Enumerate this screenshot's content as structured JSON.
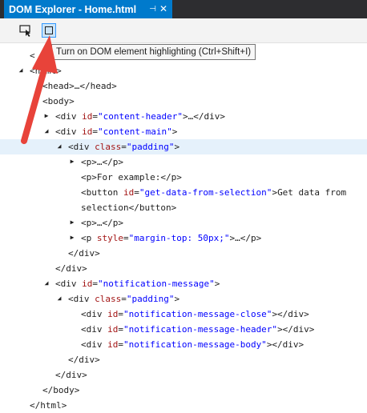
{
  "tab": {
    "title": "DOM Explorer - Home.html",
    "pin_glyph": "⊣",
    "close_glyph": "✕"
  },
  "toolbar": {
    "select_element_icon": "select-element-icon",
    "highlight_icon": "highlight-toggle-icon"
  },
  "tooltip": {
    "text": "Turn on DOM element highlighting (Ctrl+Shift+I)"
  },
  "tree": [
    {
      "indent": 37,
      "toggle": "",
      "tokens": [
        [
          "tag",
          "<"
        ]
      ]
    },
    {
      "indent": 37,
      "toggle": "expanded",
      "tokens": [
        [
          "tag",
          "<html>"
        ]
      ]
    },
    {
      "indent": 53,
      "toggle": "",
      "tokens": [
        [
          "tag",
          "<head>…</head>"
        ]
      ]
    },
    {
      "indent": 53,
      "toggle": "",
      "tokens": [
        [
          "tag",
          "<body>"
        ]
      ]
    },
    {
      "indent": 69,
      "toggle": "collapsed",
      "tokens": [
        [
          "tag",
          "<div "
        ],
        [
          "attr",
          "id"
        ],
        [
          "tag",
          "="
        ],
        [
          "val",
          "\"content-header\""
        ],
        [
          "tag",
          ">…</div>"
        ]
      ]
    },
    {
      "indent": 69,
      "toggle": "expanded",
      "tokens": [
        [
          "tag",
          "<div "
        ],
        [
          "attr",
          "id"
        ],
        [
          "tag",
          "="
        ],
        [
          "val",
          "\"content-main\""
        ],
        [
          "tag",
          ">"
        ]
      ]
    },
    {
      "indent": 85,
      "toggle": "expanded",
      "selected": true,
      "tokens": [
        [
          "tag",
          "<div "
        ],
        [
          "attr",
          "class"
        ],
        [
          "tag",
          "="
        ],
        [
          "val",
          "\"padding\""
        ],
        [
          "tag",
          ">"
        ]
      ]
    },
    {
      "indent": 101,
      "toggle": "collapsed",
      "tokens": [
        [
          "tag",
          "<p>…</p>"
        ]
      ]
    },
    {
      "indent": 101,
      "toggle": "",
      "tokens": [
        [
          "tag",
          "<p>"
        ],
        [
          "text",
          "For example:"
        ],
        [
          "tag",
          "</p>"
        ]
      ]
    },
    {
      "indent": 101,
      "toggle": "",
      "tokens": [
        [
          "tag",
          "<button "
        ],
        [
          "attr",
          "id"
        ],
        [
          "tag",
          "="
        ],
        [
          "val",
          "\"get-data-from-selection\""
        ],
        [
          "tag",
          ">"
        ],
        [
          "text",
          "Get data from"
        ]
      ]
    },
    {
      "indent": 101,
      "toggle": "",
      "tokens": [
        [
          "text",
          "selection"
        ],
        [
          "tag",
          "</button>"
        ]
      ]
    },
    {
      "indent": 101,
      "toggle": "collapsed",
      "tokens": [
        [
          "tag",
          "<p>…</p>"
        ]
      ]
    },
    {
      "indent": 101,
      "toggle": "collapsed",
      "tokens": [
        [
          "tag",
          "<p "
        ],
        [
          "attr",
          "style"
        ],
        [
          "tag",
          "="
        ],
        [
          "val",
          "\"margin-top: 50px;\""
        ],
        [
          "tag",
          ">…</p>"
        ]
      ]
    },
    {
      "indent": 85,
      "toggle": "",
      "tokens": [
        [
          "tag",
          "</div>"
        ]
      ]
    },
    {
      "indent": 69,
      "toggle": "",
      "tokens": [
        [
          "tag",
          "</div>"
        ]
      ]
    },
    {
      "indent": 69,
      "toggle": "expanded",
      "tokens": [
        [
          "tag",
          "<div "
        ],
        [
          "attr",
          "id"
        ],
        [
          "tag",
          "="
        ],
        [
          "val",
          "\"notification-message\""
        ],
        [
          "tag",
          ">"
        ]
      ]
    },
    {
      "indent": 85,
      "toggle": "expanded",
      "tokens": [
        [
          "tag",
          "<div "
        ],
        [
          "attr",
          "class"
        ],
        [
          "tag",
          "="
        ],
        [
          "val",
          "\"padding\""
        ],
        [
          "tag",
          ">"
        ]
      ]
    },
    {
      "indent": 101,
      "toggle": "",
      "tokens": [
        [
          "tag",
          "<div "
        ],
        [
          "attr",
          "id"
        ],
        [
          "tag",
          "="
        ],
        [
          "val",
          "\"notification-message-close\""
        ],
        [
          "tag",
          "></div>"
        ]
      ]
    },
    {
      "indent": 101,
      "toggle": "",
      "tokens": [
        [
          "tag",
          "<div "
        ],
        [
          "attr",
          "id"
        ],
        [
          "tag",
          "="
        ],
        [
          "val",
          "\"notification-message-header\""
        ],
        [
          "tag",
          "></div>"
        ]
      ]
    },
    {
      "indent": 101,
      "toggle": "",
      "tokens": [
        [
          "tag",
          "<div "
        ],
        [
          "attr",
          "id"
        ],
        [
          "tag",
          "="
        ],
        [
          "val",
          "\"notification-message-body\""
        ],
        [
          "tag",
          "></div>"
        ]
      ]
    },
    {
      "indent": 85,
      "toggle": "",
      "tokens": [
        [
          "tag",
          "</div>"
        ]
      ]
    },
    {
      "indent": 69,
      "toggle": "",
      "tokens": [
        [
          "tag",
          "</div>"
        ]
      ]
    },
    {
      "indent": 53,
      "toggle": "",
      "tokens": [
        [
          "tag",
          "</body>"
        ]
      ]
    },
    {
      "indent": 37,
      "toggle": "",
      "tokens": [
        [
          "tag",
          "</html>"
        ]
      ]
    }
  ],
  "colors": {
    "tab_active": "#007acc",
    "attr": "#a31515",
    "value": "#0000ff",
    "arrow": "#e8433a",
    "selected_row": "#e5f1fb"
  }
}
